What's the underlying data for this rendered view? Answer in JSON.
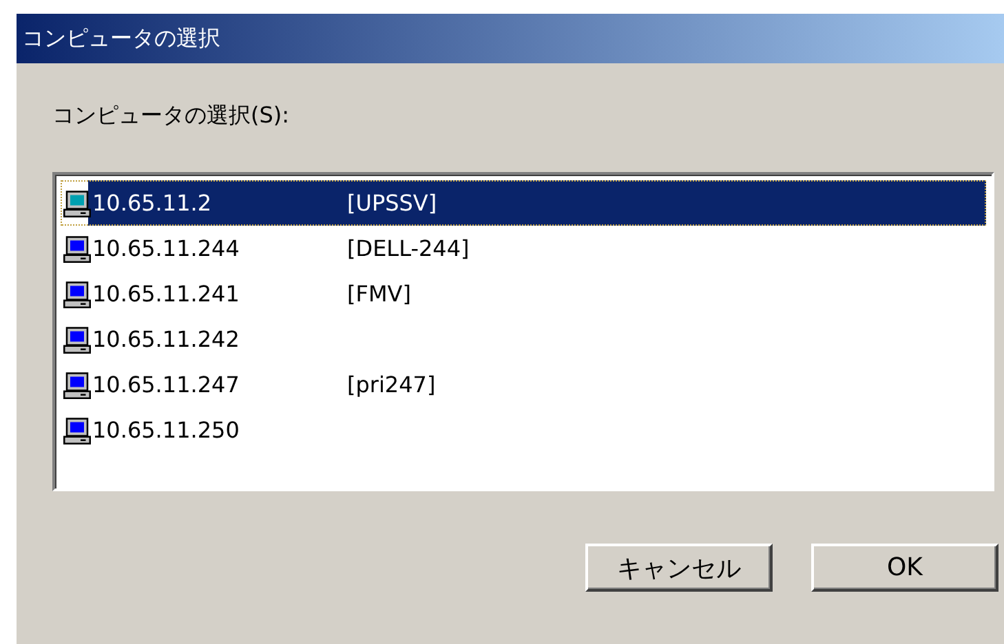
{
  "window": {
    "title": "コンピュータの選択"
  },
  "list_label": "コンピュータの選択(S):",
  "computers": [
    {
      "address": "10.65.11.2",
      "name": "[UPSSV]",
      "selected": true
    },
    {
      "address": "10.65.11.244",
      "name": "[DELL-244]",
      "selected": false
    },
    {
      "address": "10.65.11.241",
      "name": "[FMV]",
      "selected": false
    },
    {
      "address": "10.65.11.242",
      "selected": false
    },
    {
      "address": "10.65.11.247",
      "name": "[pri247]",
      "selected": false
    },
    {
      "address": "10.65.11.250",
      "selected": false
    }
  ],
  "buttons": [
    {
      "label": "キャンセル"
    },
    {
      "label": "OK"
    }
  ]
}
